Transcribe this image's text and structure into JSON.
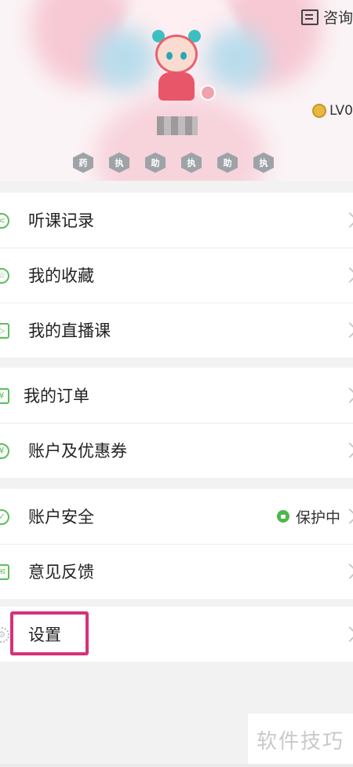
{
  "header": {
    "consult_label": "咨询",
    "level_label": "LV0",
    "badges": [
      "药",
      "执",
      "助",
      "执",
      "助",
      "执"
    ]
  },
  "menu": {
    "group1": [
      {
        "label": "听课记录",
        "icon": "history-icon"
      },
      {
        "label": "我的收藏",
        "icon": "star-icon"
      },
      {
        "label": "我的直播课",
        "icon": "tv-icon"
      }
    ],
    "group2": [
      {
        "label": "我的订单",
        "icon": "order-icon"
      },
      {
        "label": "账户及优惠券",
        "icon": "yen-icon"
      }
    ],
    "group3": [
      {
        "label": "账户安全",
        "icon": "shield-icon",
        "status": "保护中"
      },
      {
        "label": "意见反馈",
        "icon": "mail-icon"
      }
    ],
    "group4": [
      {
        "label": "设置",
        "icon": "gear-icon"
      }
    ]
  },
  "watermark": "软件技巧",
  "colors": {
    "accent": "#5cbf5a",
    "highlight": "#d6317a"
  }
}
